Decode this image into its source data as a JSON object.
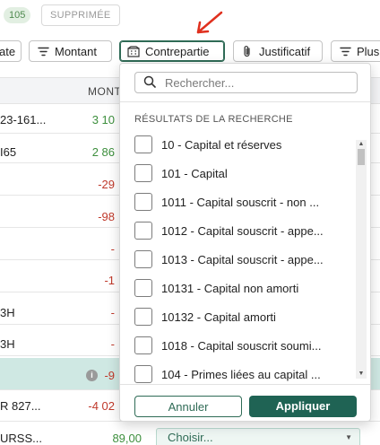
{
  "top": {
    "count_badge": "105",
    "deleted_tag": "SUPPRIMÉE"
  },
  "filters": [
    {
      "label": "ate",
      "icon": "sliders-icon"
    },
    {
      "label": "Montant",
      "icon": "filter-lines-icon"
    },
    {
      "label": "Contrepartie",
      "icon": "building-icon"
    },
    {
      "label": "Justificatif",
      "icon": "paperclip-icon"
    },
    {
      "label": "Plus",
      "icon": "filter-lines-icon"
    }
  ],
  "table": {
    "amount_header": "MONT",
    "rows": [
      {
        "label": "23-161...",
        "amount": "3 10",
        "color": "#3d8f3d"
      },
      {
        "label": "I65",
        "amount": "2 86",
        "color": "#3d8f3d"
      },
      {
        "label": "",
        "amount": "-29",
        "color": "#c0392b"
      },
      {
        "label": "",
        "amount": "-98",
        "color": "#c0392b"
      },
      {
        "label": "",
        "amount": "-",
        "color": "#c0392b"
      },
      {
        "label": "",
        "amount": "-1",
        "color": "#c0392b"
      },
      {
        "label": "3H",
        "amount": "-",
        "color": "#c0392b"
      },
      {
        "label": "3H",
        "amount": "-",
        "color": "#c0392b"
      },
      {
        "label": "",
        "amount": "-9",
        "color": "#c0392b"
      },
      {
        "label": "R 827...",
        "amount": "-4 02",
        "color": "#c0392b"
      },
      {
        "label": "URSS...",
        "amount": "89,00",
        "color": "#3d8f3d"
      }
    ],
    "info_icon": "info-icon",
    "choisir_placeholder": "Choisir..."
  },
  "dropdown": {
    "search_placeholder": "Rechercher...",
    "results_label": "RÉSULTATS DE LA RECHERCHE",
    "options": [
      "10 - Capital et réserves",
      "101 - Capital",
      "1011 - Capital souscrit - non ...",
      "1012 - Capital souscrit - appe...",
      "1013 - Capital souscrit - appe...",
      "10131 - Capital non amorti",
      "10132 - Capital amorti",
      "1018 - Capital souscrit soumi...",
      "104 - Primes liées au capital ..."
    ],
    "cancel_label": "Annuler",
    "apply_label": "Appliquer"
  },
  "colors": {
    "accent": "#1f6354",
    "annotation": "#e0301e",
    "highlight_row": "#cfe8e3"
  }
}
